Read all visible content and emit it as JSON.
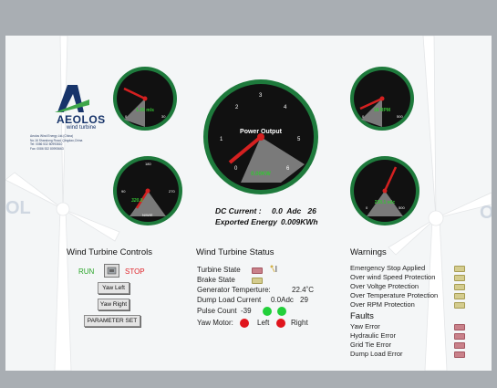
{
  "brand": {
    "name": "AEOLOS",
    "tagline": "wind turbine"
  },
  "contact_lines": [
    "Aeolos Wind Energy Ltd.(China)",
    "No.16 Shandong Road, Qingdao,China",
    "Tel: 0086 532 80993810",
    "Fax: 0086 532 80993663"
  ],
  "gauges": {
    "wind_speed": {
      "value_text": "1.36 m/s",
      "tick_min": "0",
      "tick_max": "30"
    },
    "power": {
      "title": "Power Output",
      "value_text": "0.00KW",
      "ticks": [
        "0",
        "1",
        "2",
        "3",
        "4",
        "5",
        "6"
      ]
    },
    "rpm": {
      "value_text": "18 RPM",
      "tick_min": "0",
      "tick_max": "500"
    },
    "direction": {
      "value_text": "320.8",
      "unit": "N/W/E",
      "tick_left": "90",
      "tick_top": "180",
      "tick_right": "270"
    },
    "voltage": {
      "value_text": "230.1 vdc",
      "tick_min": "0",
      "tick_max": "500"
    }
  },
  "readouts": {
    "dc_current_label": "DC Current :",
    "dc_current_value": "0.0  Adc   26",
    "energy_label": "Exported Energy",
    "energy_value": "0.009KWh"
  },
  "controls": {
    "title": "Wind Turbine Controls",
    "run_label": "RUN",
    "stop_label": "STOP",
    "yaw_left": "Yaw Left",
    "yaw_right": "Yaw Right",
    "parameter_set": "PARAMETER SET",
    "run_color": "#2ba52b",
    "stop_color": "#e0252b"
  },
  "status": {
    "title": "Wind Turbine Status",
    "turbine_state": "Turbine State",
    "brake_state": "Brake State",
    "generator_temp_label": "Generator Temperture:",
    "generator_temp_value": "22.4˚C",
    "dump_load_label": "Dump Load Current",
    "dump_load_value": "0.0Adc",
    "dump_load_extra": "29",
    "pulse_label": "Pulse Count",
    "pulse_value": "-39",
    "yaw_motor_label": "Yaw Motor:",
    "yaw_left": "Left",
    "yaw_right": "Right"
  },
  "warnings": {
    "title": "Warnings",
    "items": [
      "Emergency Stop Applied",
      "Over wind Speed Protection",
      "Over Voltge Protection",
      "Over Temperature Protection",
      "Over RPM Protection"
    ]
  },
  "faults": {
    "title": "Faults",
    "items": [
      "Yaw Error",
      "Hydraulic Error",
      "Grid Tie Error",
      "Dump Load Error"
    ]
  },
  "colors": {
    "gauge_ring": "#1e7a3c",
    "needle": "#d42020",
    "readout_green": "#35c435",
    "top_bar": "#a9aeb3"
  }
}
